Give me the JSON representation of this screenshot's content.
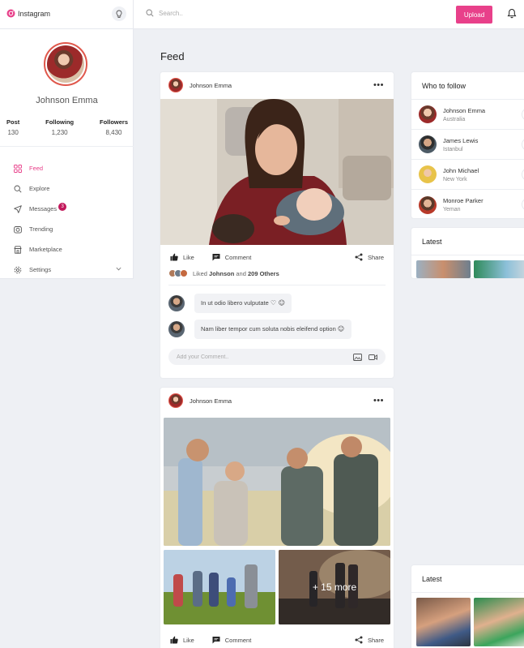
{
  "topbar": {
    "brand": "Instagram",
    "search_placeholder": "Search..",
    "upload_label": "Upload",
    "brand_color": "#e8408a"
  },
  "profile": {
    "name": "Johnson Emma",
    "stats": [
      {
        "label": "Post",
        "value": "130"
      },
      {
        "label": "Following",
        "value": "1,230"
      },
      {
        "label": "Followers",
        "value": "8,430"
      }
    ]
  },
  "nav": [
    {
      "label": "Feed",
      "icon": "grid-icon",
      "active": true
    },
    {
      "label": "Explore",
      "icon": "search-icon"
    },
    {
      "label": "Messages",
      "icon": "send-icon",
      "badge": "3"
    },
    {
      "label": "Trending",
      "icon": "camera-icon"
    },
    {
      "label": "Marketplace",
      "icon": "store-icon"
    },
    {
      "label": "Settings",
      "icon": "gear-icon"
    }
  ],
  "feed": {
    "title": "Feed",
    "post1": {
      "author": "Johnson Emma",
      "like_label": "Like",
      "comment_label": "Comment",
      "share_label": "Share",
      "liked_prefix": "Liked",
      "liked_user": "Johnson",
      "liked_and": "and",
      "liked_others": "209 Others",
      "comments": [
        {
          "text": "In ut odio libero vulputate",
          "emoji": "♡ ☺"
        },
        {
          "text": "Nam liber tempor cum soluta nobis eleifend option",
          "emoji": "☺"
        }
      ],
      "add_comment_placeholder": "Add your Comment.."
    },
    "post2": {
      "author": "Johnson Emma",
      "more_label": "+ 15 more",
      "like_label": "Like",
      "comment_label": "Comment",
      "share_label": "Share"
    }
  },
  "who_to_follow": {
    "title": "Who to follow",
    "people": [
      {
        "name": "Johnson Emma",
        "location": "Australia"
      },
      {
        "name": "James Lewis",
        "location": "Istanbul"
      },
      {
        "name": "John Michael",
        "location": "New York"
      },
      {
        "name": "Monroe Parker",
        "location": "Yeman"
      }
    ]
  },
  "latest": {
    "title": "Latest"
  },
  "latest2": {
    "title": "Latest"
  }
}
